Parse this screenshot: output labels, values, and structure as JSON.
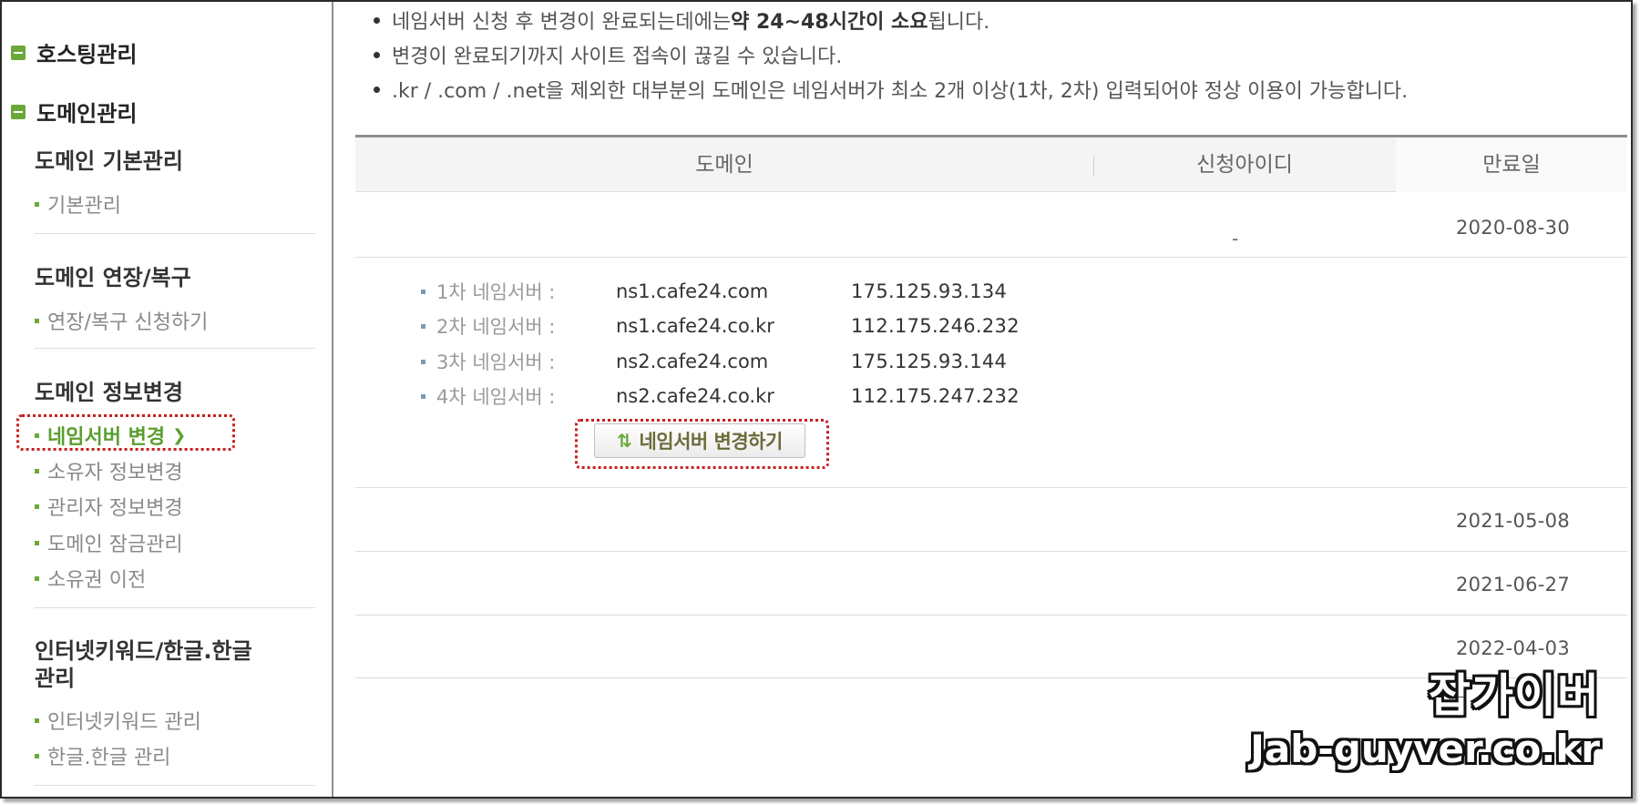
{
  "sidebar": {
    "hosting": "호스팅관리",
    "domain": "도메인관리",
    "sections": [
      {
        "title": "도메인 기본관리",
        "items": [
          "기본관리"
        ]
      },
      {
        "title": "도메인 연장/복구",
        "items": [
          "연장/복구 신청하기"
        ]
      },
      {
        "title": "도메인 정보변경",
        "items": [
          "네임서버 변경",
          "소유자 정보변경",
          "관리자 정보변경",
          "도메인 잠금관리",
          "소유권 이전"
        ]
      },
      {
        "title_line1": "인터넷키워드/한글.한글",
        "title_line2": "관리",
        "items": [
          "인터넷키워드 관리",
          "한글.한글 관리"
        ]
      }
    ]
  },
  "notices": {
    "n1_pre": "네임서버 신청 후 변경이 완료되는데에는 ",
    "n1_bold": "약 24~48시간이 소요",
    "n1_post": "됩니다.",
    "n2": "변경이 완료되기까지 사이트 접속이 끊길 수 있습니다.",
    "n3": ".kr / .com / .net을 제외한 대부분의 도메인은 네임서버가 최소 2개 이상(1차, 2차) 입력되어야 정상 이용이 가능합니다."
  },
  "table": {
    "headers": [
      "도메인",
      "신청아이디",
      "만료일"
    ],
    "row1": {
      "id": "-",
      "expiry": "2020-08-30"
    },
    "nameservers": [
      {
        "label": "1차 네임서버 :",
        "host": "ns1.cafe24.com",
        "ip": "175.125.93.134"
      },
      {
        "label": "2차 네임서버 :",
        "host": "ns1.cafe24.co.kr",
        "ip": "112.175.246.232"
      },
      {
        "label": "3차 네임서버 :",
        "host": "ns2.cafe24.com",
        "ip": "175.125.93.144"
      },
      {
        "label": "4차 네임서버 :",
        "host": "ns2.cafe24.co.kr",
        "ip": "112.175.247.232"
      }
    ],
    "change_button": "네임서버 변경하기",
    "other_expiry": [
      "2021-05-08",
      "2021-06-27",
      "2022-04-03"
    ]
  },
  "watermark": {
    "name": "잡가이버",
    "url": "Jab-guyver.co.kr"
  }
}
